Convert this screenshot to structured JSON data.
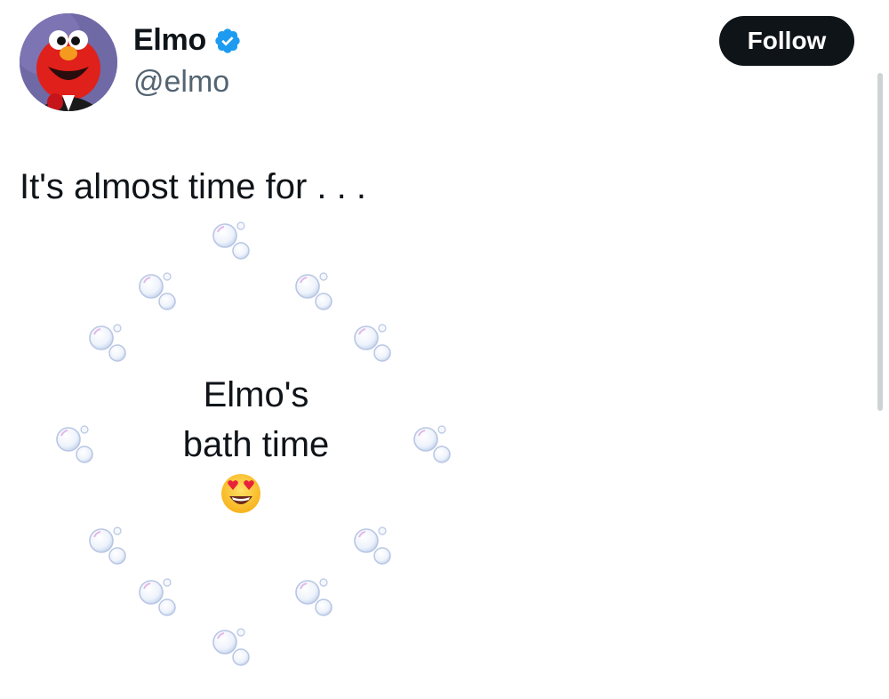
{
  "author": {
    "display_name": "Elmo",
    "handle": "@elmo",
    "verified": true,
    "avatar_icon": "elmo-avatar"
  },
  "follow_button": {
    "label": "Follow"
  },
  "tweet": {
    "intro_text": "It's almost time for . . .",
    "center_line1": "Elmo's",
    "center_line2": "bath time",
    "center_emoji": "heart-eyes-face-icon",
    "decoration_icon": "bubbles-icon"
  },
  "colors": {
    "text_primary": "#0f1419",
    "text_secondary": "#536471",
    "button_bg": "#0f1419",
    "verified_blue": "#1d9bf0"
  }
}
